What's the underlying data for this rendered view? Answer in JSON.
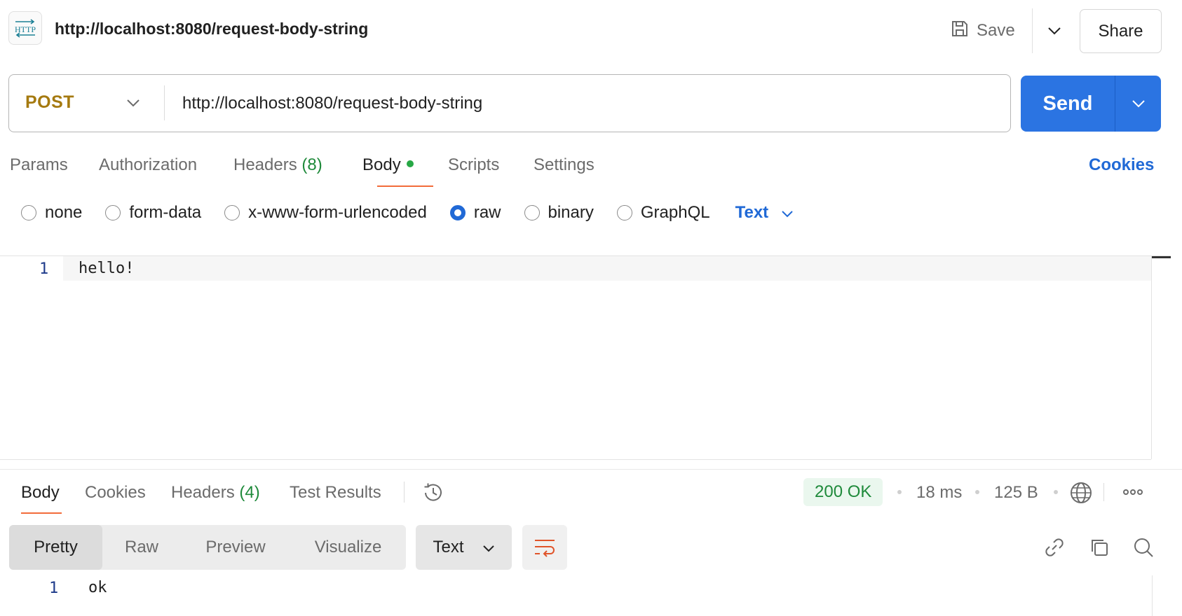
{
  "header": {
    "icon": "http-icon",
    "badge_text": "HTTP",
    "title": "http://localhost:8080/request-body-string",
    "save_label": "Save",
    "share_label": "Share"
  },
  "request": {
    "method": "POST",
    "url": "http://localhost:8080/request-body-string",
    "send_label": "Send"
  },
  "request_tabs": {
    "params": "Params",
    "authorization": "Authorization",
    "headers": "Headers",
    "headers_count": "(8)",
    "body": "Body",
    "scripts": "Scripts",
    "settings": "Settings",
    "cookies": "Cookies",
    "active": "Body"
  },
  "body_types": {
    "none": "none",
    "form_data": "form-data",
    "urlencoded": "x-www-form-urlencoded",
    "raw": "raw",
    "binary": "binary",
    "graphql": "GraphQL",
    "selected": "raw",
    "format": "Text"
  },
  "editor": {
    "line_number": "1",
    "content": "hello!"
  },
  "response_tabs": {
    "body": "Body",
    "cookies": "Cookies",
    "headers": "Headers",
    "headers_count": "(4)",
    "test_results": "Test Results",
    "active": "Body"
  },
  "response_meta": {
    "status": "200 OK",
    "time": "18 ms",
    "size": "125 B"
  },
  "response_view": {
    "pretty": "Pretty",
    "raw": "Raw",
    "preview": "Preview",
    "visualize": "Visualize",
    "active": "Pretty",
    "format": "Text"
  },
  "response_body": {
    "line_number": "1",
    "content": "ok"
  },
  "colors": {
    "accent_blue": "#2b74e2",
    "method_post": "#a57a10",
    "status_ok": "#1f8a3b",
    "tab_underline": "#f26b3a"
  }
}
